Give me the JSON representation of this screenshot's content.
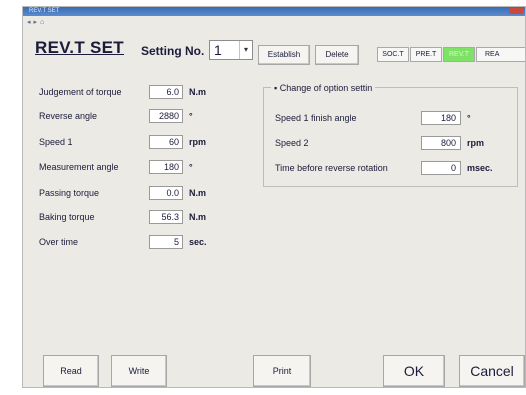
{
  "window": {
    "title": "REV.T SET"
  },
  "header": {
    "title": "REV.T SET",
    "setting_label": "Setting No.",
    "setting_value": "1",
    "establish_label": "Establish",
    "delete_label": "Delete"
  },
  "tabs": [
    {
      "label": "SOC.T",
      "active": false
    },
    {
      "label": "PRE.T",
      "active": false
    },
    {
      "label": "REV.T",
      "active": true
    },
    {
      "label": "REA",
      "active": false
    }
  ],
  "params": [
    {
      "label": "Judgement of torque",
      "value": "6.0",
      "unit": "N.m"
    },
    {
      "label": "Reverse angle",
      "value": "2880",
      "unit": "°"
    },
    {
      "label": "Speed 1",
      "value": "60",
      "unit": "rpm"
    },
    {
      "label": "Measurement angle",
      "value": "180",
      "unit": "°"
    },
    {
      "label": "Passing torque",
      "value": "0.0",
      "unit": "N.m"
    },
    {
      "label": "Baking torque",
      "value": "56.3",
      "unit": "N.m"
    },
    {
      "label": "Over time",
      "value": "5",
      "unit": "sec."
    }
  ],
  "options": {
    "title": "Change of option settin",
    "rows": [
      {
        "label": "Speed 1 finish angle",
        "value": "180",
        "unit": "°"
      },
      {
        "label": "Speed 2",
        "value": "800",
        "unit": "rpm"
      },
      {
        "label": "Time before reverse rotation",
        "value": "0",
        "unit": "msec."
      }
    ]
  },
  "buttons": {
    "read": "Read",
    "write": "Write",
    "print": "Print",
    "ok": "OK",
    "cancel": "Cancel"
  },
  "colors": {
    "active_tab": "#7ee266",
    "titlebar": "#3a6db0"
  }
}
